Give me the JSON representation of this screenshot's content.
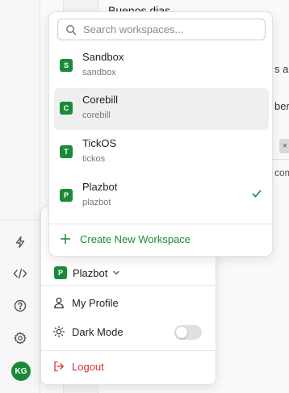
{
  "colors": {
    "accent": "#1a8a3a",
    "danger": "#d6332d"
  },
  "background": {
    "greeting": "Buenos dias",
    "fragments": [
      "s a",
      "ber",
      "com"
    ],
    "chip_icon": "close-icon",
    "chip_glyph": "×"
  },
  "sidebar": {
    "icons": [
      "lightning-icon",
      "code-icon",
      "help-icon",
      "settings-icon"
    ],
    "avatar_initials": "KG"
  },
  "workspace_menu": {
    "search_placeholder": "Search workspaces...",
    "items": [
      {
        "badge": "S",
        "name": "Sandbox",
        "slug": "sandbox",
        "hovered": false,
        "selected": false
      },
      {
        "badge": "C",
        "name": "Corebill",
        "slug": "corebill",
        "hovered": true,
        "selected": false
      },
      {
        "badge": "T",
        "name": "TickOS",
        "slug": "tickos",
        "hovered": false,
        "selected": false
      },
      {
        "badge": "P",
        "name": "Plazbot",
        "slug": "plazbot",
        "hovered": false,
        "selected": true
      }
    ],
    "create_label": "Create New Workspace"
  },
  "profile_menu": {
    "workspace_badge": "P",
    "workspace_name": "Plazbot",
    "my_profile": "My Profile",
    "dark_mode": "Dark Mode",
    "dark_mode_enabled": false,
    "logout": "Logout"
  }
}
